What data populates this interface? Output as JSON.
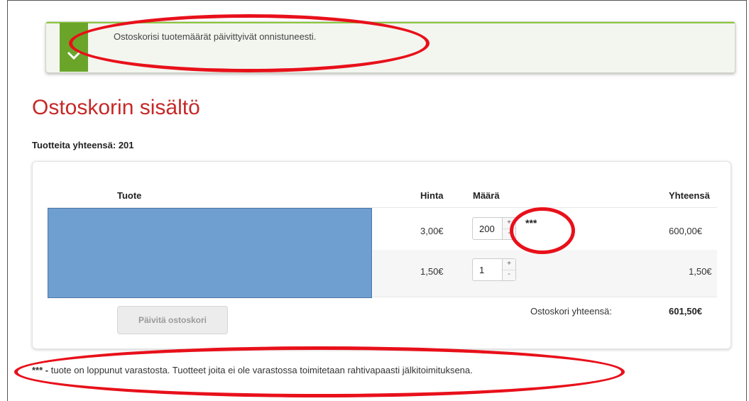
{
  "alert": {
    "message": "Ostoskorisi tuotemäärät päivittyivät onnistuneesti.",
    "icon": "check-icon",
    "color": "#6aa52a"
  },
  "page": {
    "title": "Ostoskorin sisältö",
    "product_count": "Tuotteita yhteensä: 201"
  },
  "cart": {
    "headers": {
      "product": "Tuote",
      "price": "Hinta",
      "quantity": "Määrä",
      "total": "Yhteensä"
    },
    "rows": [
      {
        "price": "3,00€",
        "quantity": "200",
        "stock_marker": "***",
        "total": "600,00€"
      },
      {
        "price": "1,50€",
        "quantity": "1",
        "stock_marker": "",
        "total": "1,50€"
      }
    ],
    "stepper": {
      "plus": "+",
      "minus": "-"
    },
    "update_button": "Päivitä ostoskori",
    "grand_total_label": "Ostoskori yhteensä:",
    "grand_total_value": "601,50€"
  },
  "footnote": {
    "marker": "***",
    "dash": " - ",
    "text": "tuote on loppunut varastosta. Tuotteet joita ei ole varastossa toimitetaan rahtivapaasti jälkitoimituksena."
  },
  "colors": {
    "title": "#c62828",
    "annotation": "#e8101a",
    "product_placeholder": "#6f9fd0"
  }
}
